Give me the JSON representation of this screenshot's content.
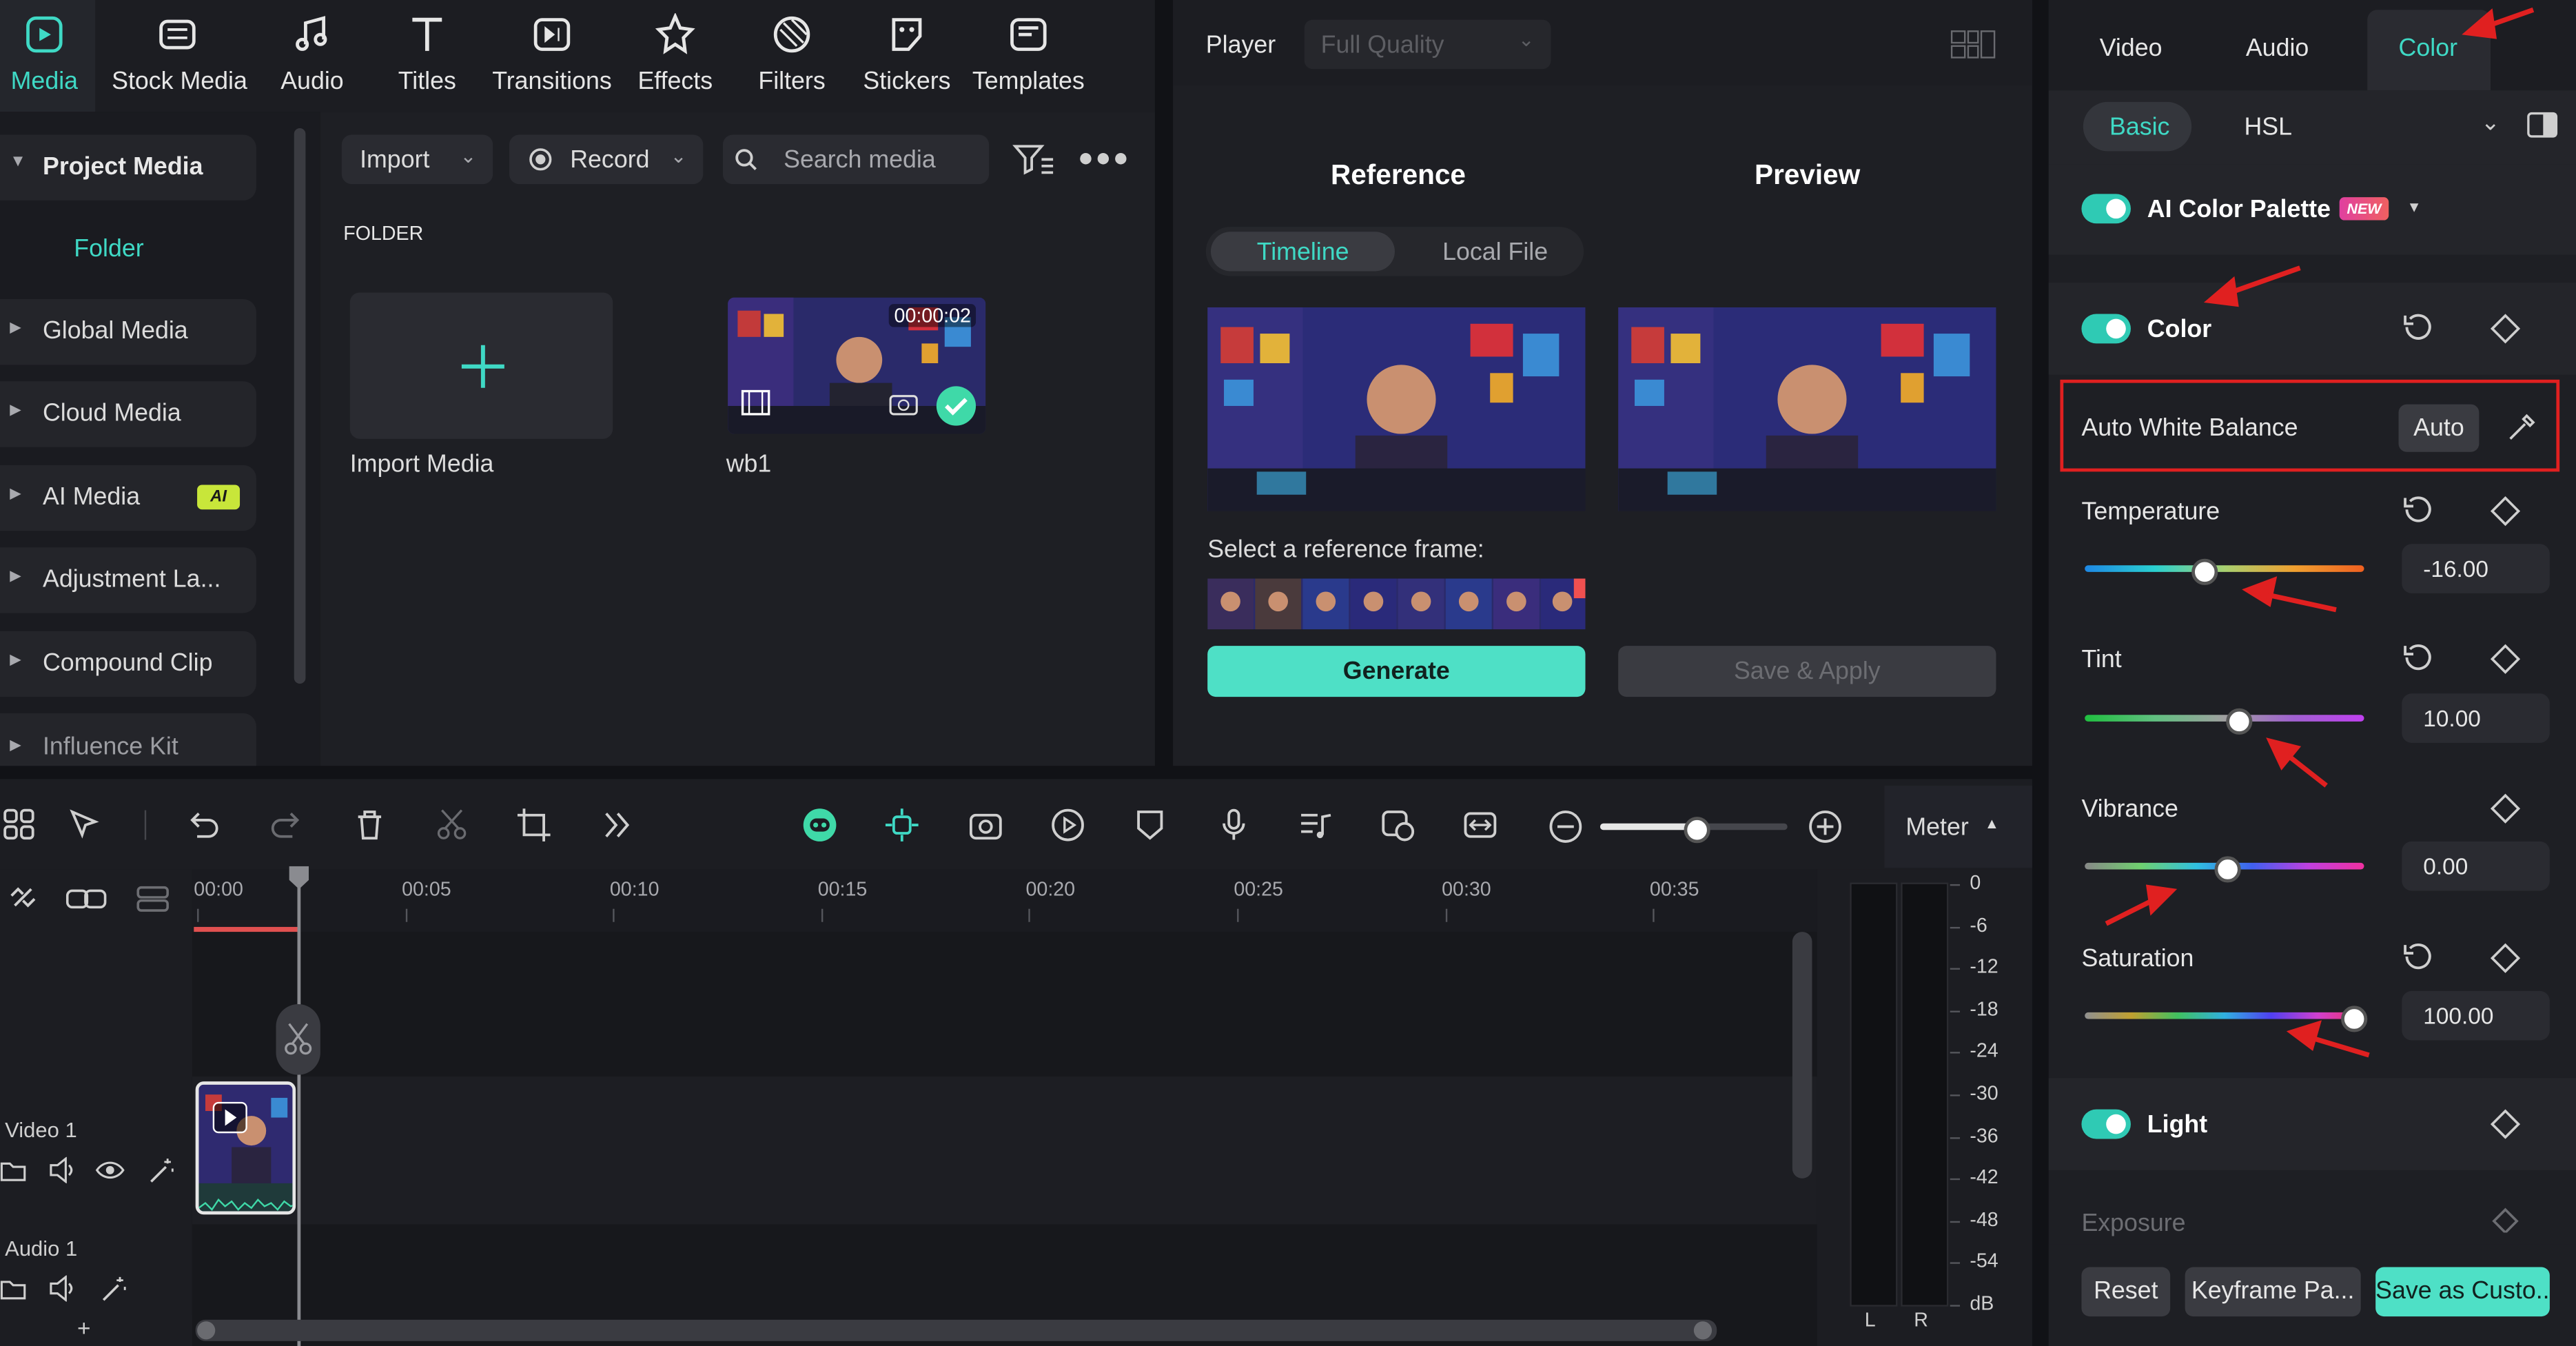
{
  "toolbar_tabs": [
    {
      "label": "Media",
      "icon": "media-icon"
    },
    {
      "label": "Stock Media",
      "icon": "stock-media-icon"
    },
    {
      "label": "Audio",
      "icon": "music-note-icon"
    },
    {
      "label": "Titles",
      "icon": "title-t-icon"
    },
    {
      "label": "Transitions",
      "icon": "transitions-icon"
    },
    {
      "label": "Effects",
      "icon": "effects-star-icon"
    },
    {
      "label": "Filters",
      "icon": "filters-icon"
    },
    {
      "label": "Stickers",
      "icon": "sticker-icon"
    },
    {
      "label": "Templates",
      "icon": "templates-icon"
    }
  ],
  "sidebar": {
    "items": [
      {
        "label": "Project Media"
      },
      {
        "label": "Folder"
      },
      {
        "label": "Global Media"
      },
      {
        "label": "Cloud Media"
      },
      {
        "label": "AI Media",
        "badge": "AI"
      },
      {
        "label": "Adjustment La..."
      },
      {
        "label": "Compound Clip"
      },
      {
        "label": "Influence Kit"
      }
    ]
  },
  "media": {
    "import_label": "Import",
    "record_label": "Record",
    "search_placeholder": "Search media",
    "folder_heading": "FOLDER",
    "import_media_label": "Import Media",
    "clip_name": "wb1",
    "clip_duration": "00:00:02"
  },
  "player": {
    "title": "Player",
    "quality": "Full Quality",
    "reference_label": "Reference",
    "preview_label": "Preview",
    "tab_timeline": "Timeline",
    "tab_local_file": "Local File",
    "select_frame_label": "Select a reference frame:",
    "generate_label": "Generate",
    "save_apply_label": "Save & Apply"
  },
  "timeline": {
    "meter_label": "Meter",
    "ruler": [
      "00:00",
      "00:05",
      "00:10",
      "00:15",
      "00:20",
      "00:25",
      "00:30",
      "00:35"
    ],
    "meter_scale": [
      "0",
      "-6",
      "-12",
      "-18",
      "-24",
      "-30",
      "-36",
      "-42",
      "-48",
      "-54",
      "dB"
    ],
    "meter_channels": [
      "L",
      "R"
    ],
    "video_track": "Video 1",
    "audio_track": "Audio 1",
    "zoom_level": 0.5
  },
  "inspector": {
    "tabs": [
      "Video",
      "Audio",
      "Color"
    ],
    "active_tab": "Color",
    "subtabs": [
      "Basic",
      "HSL"
    ],
    "active_subtab": "Basic",
    "ai_palette_label": "AI Color Palette",
    "ai_palette_badge": "NEW",
    "color_section": "Color",
    "awb_label": "Auto White Balance",
    "awb_button": "Auto",
    "temperature": {
      "label": "Temperature",
      "value": "-16.00",
      "position": 0.42
    },
    "tint": {
      "label": "Tint",
      "value": "10.00",
      "position": 0.54
    },
    "vibrance": {
      "label": "Vibrance",
      "value": "0.00",
      "position": 0.5
    },
    "saturation": {
      "label": "Saturation",
      "value": "100.00",
      "position": 0.95
    },
    "light_section": "Light",
    "exposure_label": "Exposure",
    "reset_label": "Reset",
    "keyframe_label": "Keyframe Pa...",
    "save_custom_label": "Save as Custo..."
  },
  "colors": {
    "accent": "#3fd9c5",
    "generate": "#4ee0c6",
    "annotation_red": "#e02020"
  }
}
